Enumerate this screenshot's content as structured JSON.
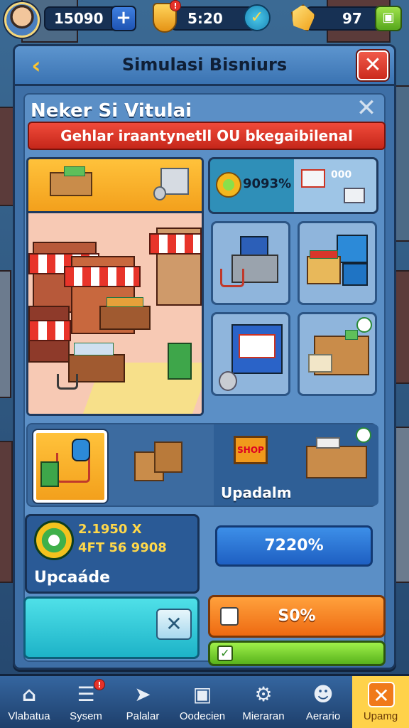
{
  "hud": {
    "coins": "15090",
    "plus_icon": "plus-icon",
    "shield_badge": "!",
    "timer": "5:20",
    "gems": "97"
  },
  "panel": {
    "title": "Simulasi Bisniurs",
    "close_glyph": "✕",
    "back_glyph": "‹"
  },
  "sub": {
    "title": "Neker Si Vitulai",
    "banner": "Gehlar iraantynetll OU bkegaibilenal"
  },
  "stat": {
    "value": "9093%",
    "value2": "000"
  },
  "items": {
    "sign_text": "SHOP",
    "upgrade_label": "Upadalm"
  },
  "coin_card": {
    "line1": "2.1950 X",
    "line2": "4FT 56 9908",
    "label": "Upcaáde"
  },
  "pct_button": "7220%",
  "orange_button": "S0%",
  "nav": [
    {
      "label": "Vlabatua",
      "icon": "home-icon",
      "glyph": "⌂"
    },
    {
      "label": "Sysem",
      "icon": "checklist-icon",
      "glyph": "☰",
      "badge": "!"
    },
    {
      "label": "Palalar",
      "icon": "plane-icon",
      "glyph": "➤"
    },
    {
      "label": "Oodecien",
      "icon": "building-icon",
      "glyph": "▣"
    },
    {
      "label": "Mieraran",
      "icon": "gear-icon",
      "glyph": "⚙"
    },
    {
      "label": "Aerario",
      "icon": "character-icon",
      "glyph": "☻"
    },
    {
      "label": "Upamg",
      "icon": "tools-icon",
      "glyph": "✕"
    }
  ],
  "colors": {
    "accent": "#ffc23b",
    "panel": "#3e6fa6",
    "danger": "#cc2a1d",
    "success": "#58b31c"
  }
}
